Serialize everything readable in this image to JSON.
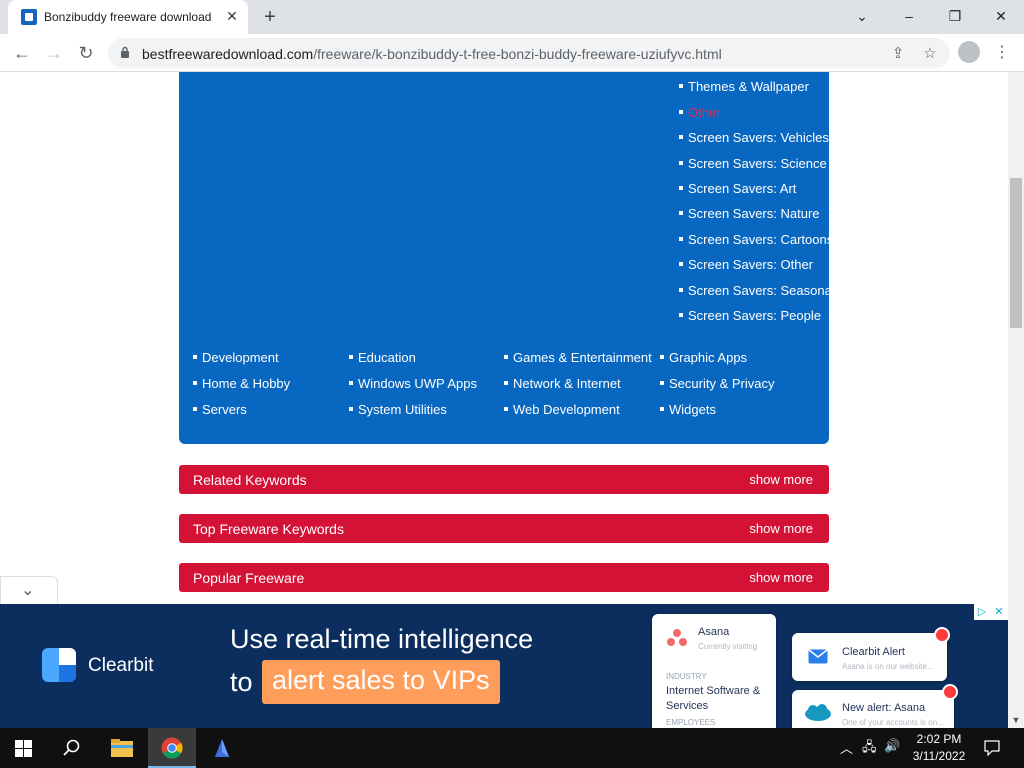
{
  "browser": {
    "tab_title": "Bonzibuddy freeware download",
    "close_tab_glyph": "✕",
    "new_tab_glyph": "+",
    "window_controls": {
      "minimize": "–",
      "maximize": "❐",
      "close": "✕",
      "tabsearch": "⌄"
    },
    "url_host": "bestfreewaredownload.com",
    "url_path": "/freeware/k-bonzibuddy-t-free-bonzi-buddy-freeware-uziufyvc.html",
    "nav": {
      "back": "←",
      "forward": "→",
      "reload": "↻"
    },
    "icons": {
      "share": "⇪",
      "bookmark": "☆",
      "menu": "⋮"
    }
  },
  "page": {
    "subcategories": [
      "Themes & Wallpaper",
      "Other",
      "Screen Savers: Vehicles",
      "Screen Savers: Science",
      "Screen Savers: Art",
      "Screen Savers: Nature",
      "Screen Savers: Cartoons",
      "Screen Savers: Other",
      "Screen Savers: Seasonal",
      "Screen Savers: People"
    ],
    "active_subcategory_index": 1,
    "categories": [
      [
        "Development",
        "Education",
        "Games & Entertainment",
        "Graphic Apps"
      ],
      [
        "Home & Hobby",
        "Windows UWP Apps",
        "Network & Internet",
        "Security & Privacy"
      ],
      [
        "Servers",
        "System Utilities",
        "Web Development",
        "Widgets"
      ]
    ],
    "sections": [
      {
        "label": "Related Keywords",
        "more": "show more"
      },
      {
        "label": "Top Freeware Keywords",
        "more": "show more"
      },
      {
        "label": "Popular Freeware",
        "more": "show more"
      }
    ],
    "collapse_glyph": "⌄"
  },
  "ad": {
    "brand": "Clearbit",
    "line1": "Use real-time intelligence",
    "line2_prefix": "to",
    "line2_highlight": "alert sales to VIPs",
    "company_card": {
      "name": "Asana",
      "status": "Currently visiting",
      "industry_label": "INDUSTRY",
      "industry": "Internet Software & Services",
      "employees_label": "EMPLOYEES"
    },
    "alert_card_1": {
      "title": "Clearbit Alert",
      "body": "Asana is on our website..."
    },
    "alert_card_2": {
      "title": "New alert: Asana",
      "body": "One of your accounts is on..."
    },
    "controls": {
      "info": "▷",
      "close": "✕"
    },
    "colors": {
      "background": "#0c2e5e",
      "highlight": "#ff9e5a"
    }
  },
  "taskbar": {
    "time": "2:02 PM",
    "date": "3/11/2022",
    "icons": [
      "windows-start-icon",
      "search-icon",
      "file-explorer-icon",
      "chrome-icon",
      "app-icon"
    ]
  },
  "colors": {
    "category_box": "#0867c1",
    "section_bar": "#d41236",
    "active_link": "#e8284a"
  }
}
